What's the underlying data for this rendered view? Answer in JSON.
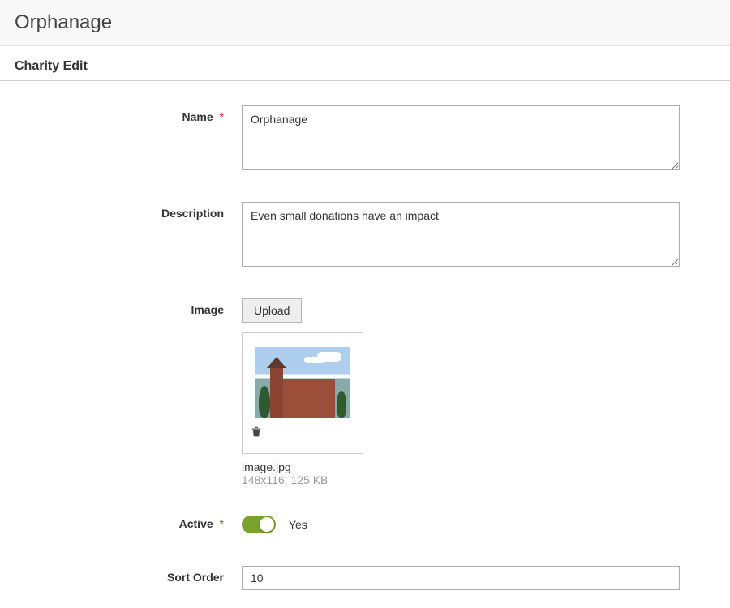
{
  "header": {
    "title": "Orphanage"
  },
  "section": {
    "title": "Charity Edit"
  },
  "form": {
    "name": {
      "label": "Name",
      "required": "*",
      "value": "Orphanage"
    },
    "description": {
      "label": "Description",
      "value": "Even small donations have an impact"
    },
    "image": {
      "label": "Image",
      "upload_button": "Upload",
      "file_name": "image.jpg",
      "file_meta": "148x116, 125 KB"
    },
    "active": {
      "label": "Active",
      "required": "*",
      "state_label": "Yes"
    },
    "sort_order": {
      "label": "Sort Order",
      "value": "10"
    }
  }
}
